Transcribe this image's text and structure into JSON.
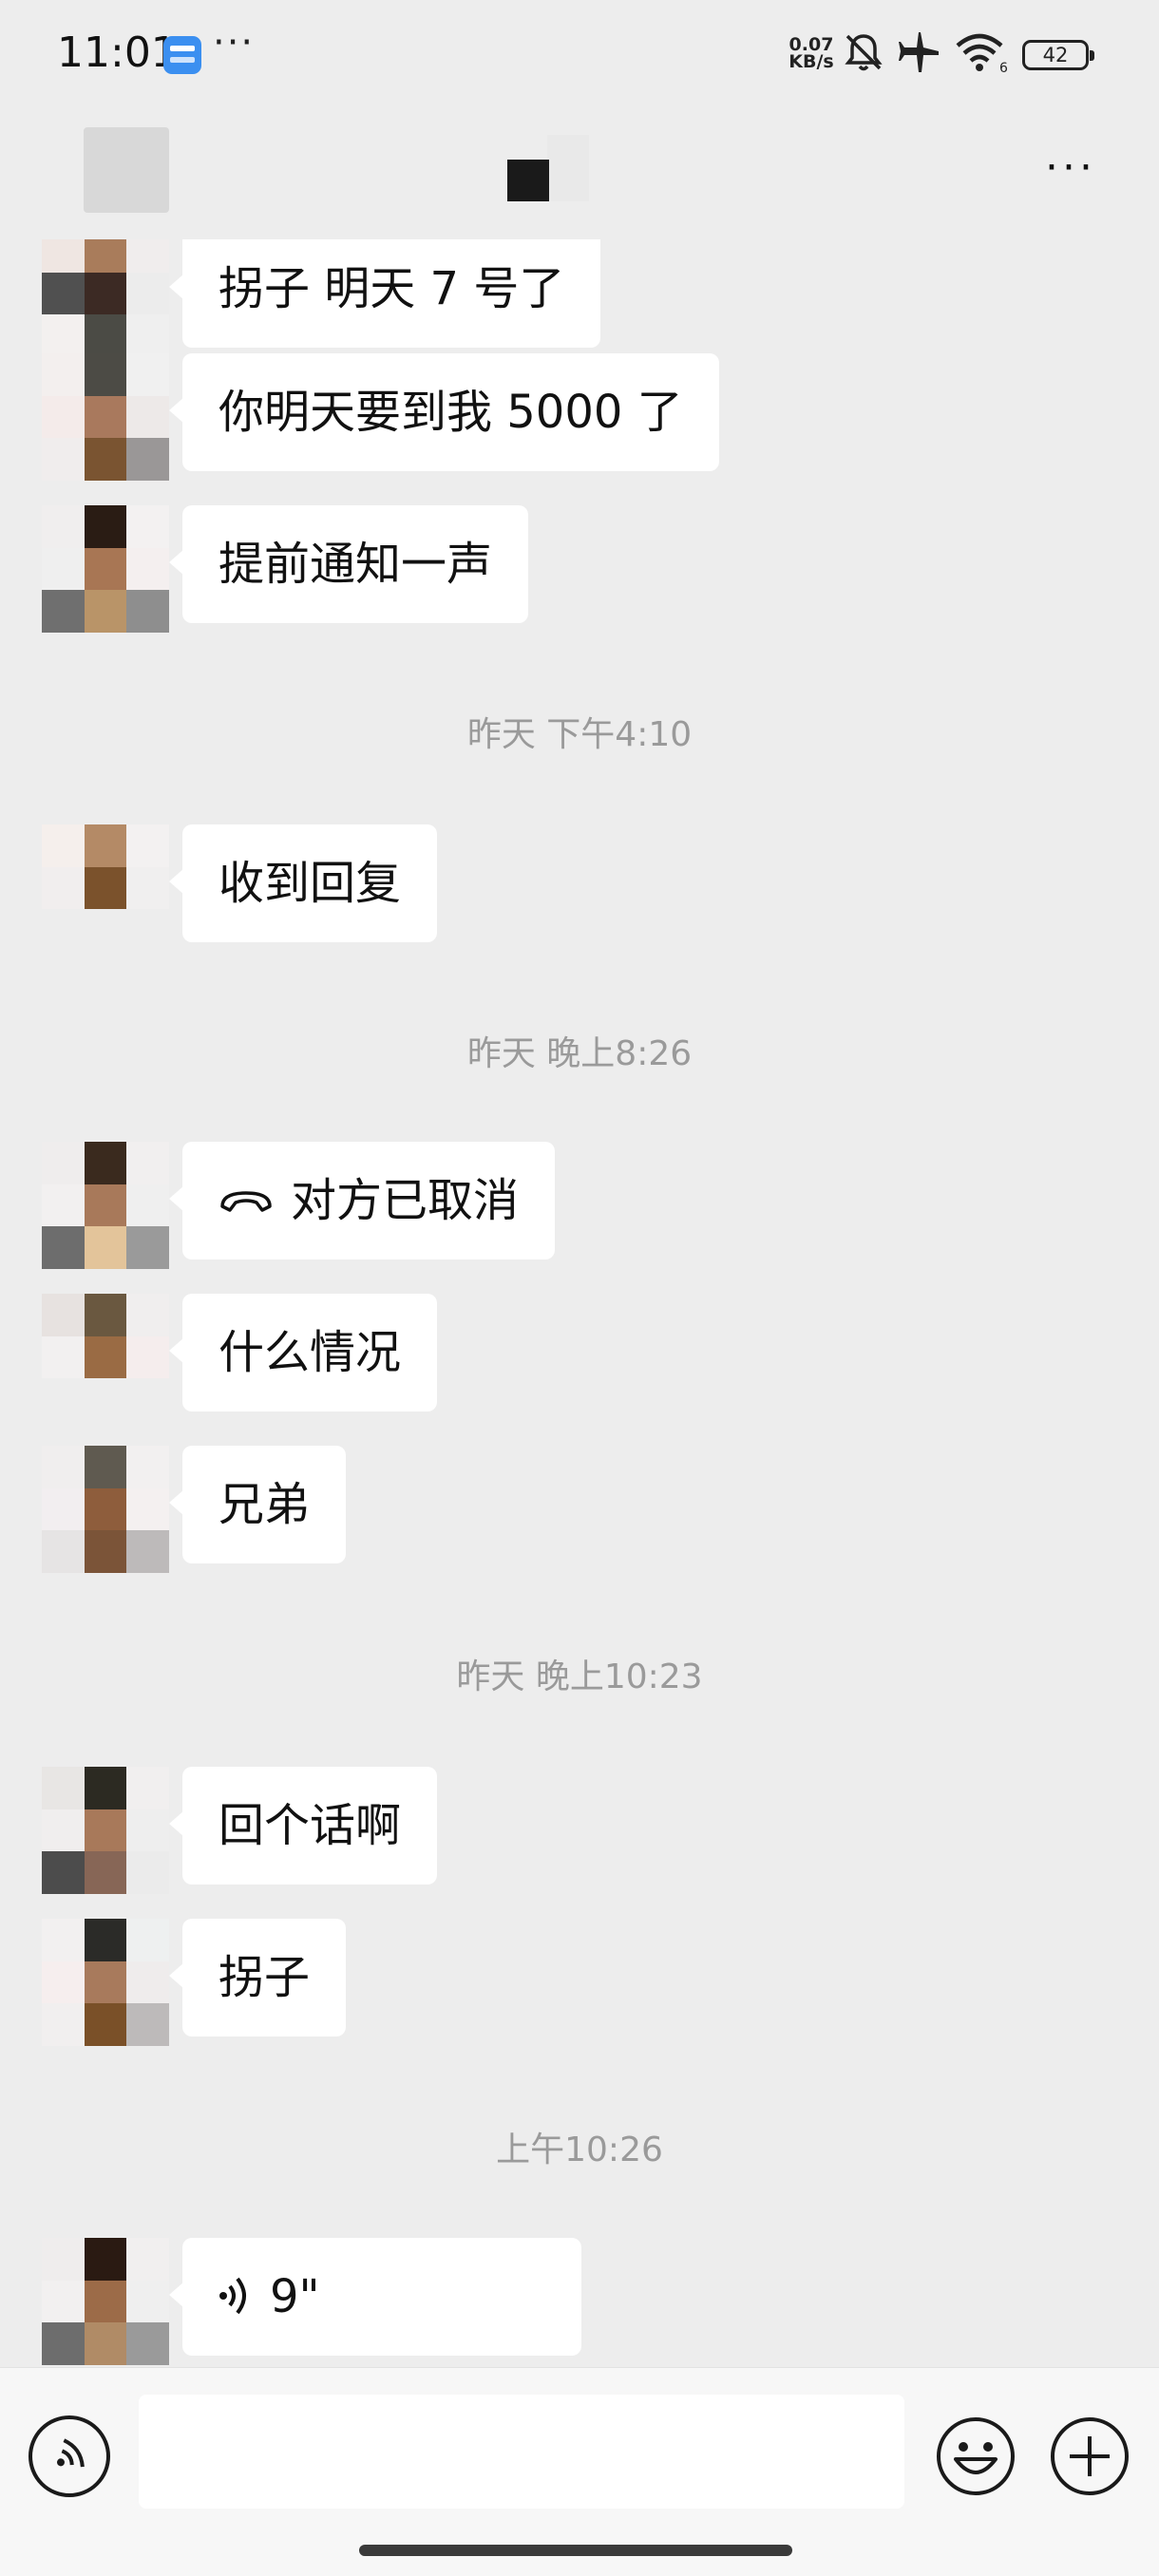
{
  "status_bar": {
    "time": "11:01",
    "more": "···",
    "net_speed_value": "0.07",
    "net_speed_unit": "KB/s",
    "battery": "42"
  },
  "header": {
    "more": "···"
  },
  "messages": [
    {
      "type": "text",
      "text": "拐子   明天 7 号了"
    },
    {
      "type": "text",
      "text": "你明天要到我 5000 了"
    },
    {
      "type": "text",
      "text": "提前通知一声"
    },
    {
      "type": "time",
      "text": "昨天 下午4:10"
    },
    {
      "type": "text",
      "text": "收到回复"
    },
    {
      "type": "time",
      "text": "昨天 晚上8:26"
    },
    {
      "type": "call",
      "text": "对方已取消",
      "icon": "call-declined-icon"
    },
    {
      "type": "text",
      "text": "什么情况"
    },
    {
      "type": "text",
      "text": "兄弟"
    },
    {
      "type": "time",
      "text": "昨天 晚上10:23"
    },
    {
      "type": "text",
      "text": " 回个话啊"
    },
    {
      "type": "text",
      "text": "拐子"
    },
    {
      "type": "time",
      "text": "上午10:26"
    },
    {
      "type": "voice",
      "text": "9\"",
      "icon": "voice-wave-icon"
    }
  ],
  "input_bar": {
    "value": "",
    "icons": [
      "voice-input-icon",
      "emoji-icon",
      "plus-icon"
    ]
  },
  "colors": {
    "background": "#ededed",
    "bubble": "#ffffff",
    "timestamp": "#9a9a9a"
  }
}
